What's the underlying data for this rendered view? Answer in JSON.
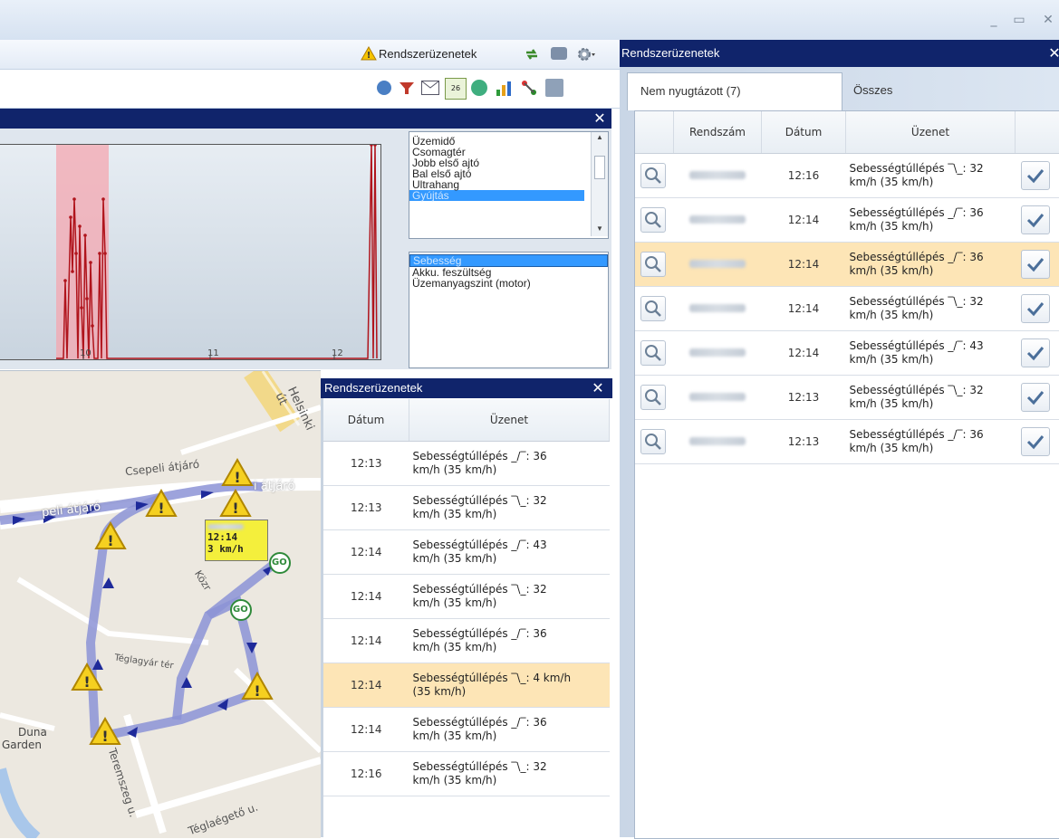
{
  "toolbar": {
    "system_messages_label": "Rendszerüzenetek"
  },
  "chart": {
    "signals_list": [
      "Üzemidő",
      "Csomagtér",
      "Jobb első ajtó",
      "Bal első ajtó",
      "Ultrahang",
      "Gyújtás"
    ],
    "signals_selected": "Gyújtás",
    "values_list": [
      "Sebesség",
      "Akku. feszültség",
      "Üzemanyagszint (motor)"
    ],
    "values_selected": "Sebesség",
    "x_ticks": [
      "10",
      "11",
      "12"
    ],
    "colors": {
      "series": "#b0141c",
      "highlight": "#f4a7b0"
    }
  },
  "map": {
    "labels": {
      "street_helsinki": "Helsinki út",
      "street_csepeli": "Csepeli átjáró",
      "street_atjaro_right": "i átjáró",
      "street_atjaro_left": "peli átjáró",
      "street_kozr": "Közr",
      "street_teglagyar": "Téglagyár tér",
      "street_teremszeg": "Teremszeg u.",
      "street_teglaegeto": "Téglaégető u.",
      "place_duna": "Duna",
      "place_garden": "Garden"
    },
    "popup": {
      "time": "12:14",
      "speed": "3 km/h"
    },
    "go_label": "GO"
  },
  "mid_panel": {
    "title": "Rendszerüzenetek",
    "columns": [
      "Dátum",
      "Üzenet"
    ],
    "rows": [
      {
        "time": "12:13",
        "msg1": "Sebességtúllépés _/‾: 36",
        "msg2": "km/h (35 km/h)"
      },
      {
        "time": "12:13",
        "msg1": "Sebességtúllépés ‾\\_: 32",
        "msg2": "km/h (35 km/h)"
      },
      {
        "time": "12:14",
        "msg1": "Sebességtúllépés _/‾: 43",
        "msg2": "km/h (35 km/h)"
      },
      {
        "time": "12:14",
        "msg1": "Sebességtúllépés ‾\\_: 32",
        "msg2": "km/h (35 km/h)"
      },
      {
        "time": "12:14",
        "msg1": "Sebességtúllépés _/‾: 36",
        "msg2": "km/h (35 km/h)"
      },
      {
        "time": "12:14",
        "msg1": "Sebességtúllépés ‾\\_: 4 km/h",
        "msg2": "(35 km/h)",
        "highlight": true
      },
      {
        "time": "12:14",
        "msg1": "Sebességtúllépés _/‾: 36",
        "msg2": "km/h (35 km/h)"
      },
      {
        "time": "12:16",
        "msg1": "Sebességtúllépés ‾\\_: 32",
        "msg2": "km/h (35 km/h)"
      }
    ]
  },
  "right_panel": {
    "title": "Rendszerüzenetek",
    "tabs": [
      "Nem nyugtázott (7)",
      "Összes"
    ],
    "columns": [
      "Rendszám",
      "Dátum",
      "Üzenet"
    ],
    "rows": [
      {
        "time": "12:16",
        "msg1": "Sebességtúllépés ‾\\_: 32",
        "msg2": "km/h (35 km/h)"
      },
      {
        "time": "12:14",
        "msg1": "Sebességtúllépés _/‾: 36",
        "msg2": "km/h (35 km/h)"
      },
      {
        "time": "12:14",
        "msg1": "Sebességtúllépés _/‾: 36",
        "msg2": "km/h (35 km/h)",
        "highlight": true
      },
      {
        "time": "12:14",
        "msg1": "Sebességtúllépés ‾\\_: 32",
        "msg2": "km/h (35 km/h)"
      },
      {
        "time": "12:14",
        "msg1": "Sebességtúllépés _/‾: 43",
        "msg2": "km/h (35 km/h)"
      },
      {
        "time": "12:13",
        "msg1": "Sebességtúllépés ‾\\_: 32",
        "msg2": "km/h (35 km/h)"
      },
      {
        "time": "12:13",
        "msg1": "Sebességtúllépés _/‾: 36",
        "msg2": "km/h (35 km/h)"
      }
    ]
  },
  "colors": {
    "panel_header": "#10246b",
    "accent": "#3399ff",
    "highlight_row": "#fde5b6"
  }
}
